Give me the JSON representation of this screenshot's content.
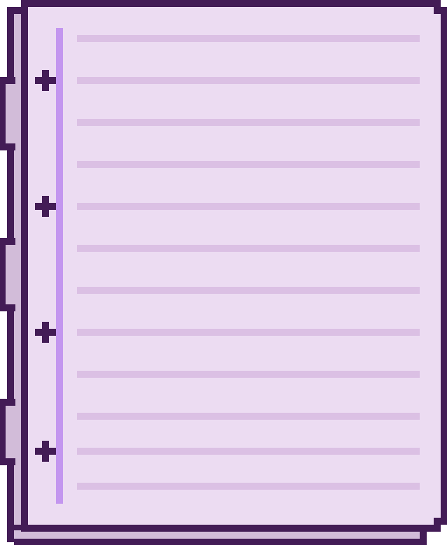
{
  "illustration": {
    "subject": "notebook-page",
    "style": "pixel-art",
    "ruled_line_count": 12,
    "binding_plus_marks": 4,
    "colors": {
      "outline": "#431c56",
      "page_fill": "#ecdcf2",
      "back_page_fill": "#d2bcd9",
      "ruled_line": "#dbc0e4",
      "margin_line": "#c396ef"
    }
  }
}
